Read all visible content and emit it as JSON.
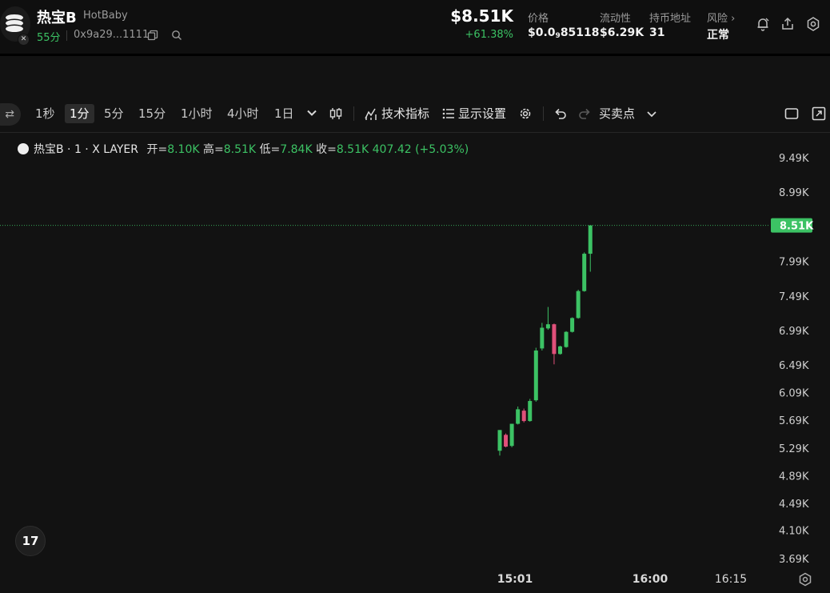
{
  "header": {
    "token_name": "热宝B",
    "token_symbol": "HotBaby",
    "age": "55分",
    "address": "0x9a29...1111",
    "price": "$8.51K",
    "change": "+61.38%",
    "stats": [
      {
        "label": "价格",
        "value_prefix": "$0.0",
        "value_sub": "9",
        "value_suffix": "85118"
      },
      {
        "label": "流动性",
        "value": "$6.29K"
      },
      {
        "label": "持币地址",
        "value": "31"
      },
      {
        "label": "风险",
        "value": "正常"
      }
    ],
    "icons": [
      "copy-icon",
      "search-icon",
      "bell-icon",
      "share-icon",
      "settings-icon"
    ]
  },
  "toolbar": {
    "timeframes": [
      "1秒",
      "1分",
      "5分",
      "15分",
      "1小时",
      "4小时",
      "1日"
    ],
    "active_timeframe": "1分",
    "indicators_label": "技术指标",
    "display_label": "显示设置",
    "trade_points_label": "买卖点"
  },
  "legend": {
    "symbol": "热宝B · 1 · X LAYER",
    "open_label": "开=",
    "open": "8.10K",
    "high_label": "高=",
    "high": "8.51K",
    "low_label": "低=",
    "low": "7.84K",
    "close_label": "收=",
    "close": "8.51K",
    "change": "407.42 (+5.03%)"
  },
  "chart_data": {
    "type": "candlestick",
    "y_ticks": [
      "9.49K",
      "8.99K",
      "8.51K",
      "7.99K",
      "7.49K",
      "6.99K",
      "6.49K",
      "6.09K",
      "5.69K",
      "5.29K",
      "4.89K",
      "4.49K",
      "4.10K",
      "3.69K"
    ],
    "y_tick_values": [
      9490,
      8990,
      8510,
      7990,
      7490,
      6990,
      6490,
      6090,
      5690,
      5290,
      4890,
      4490,
      4100,
      3690
    ],
    "x_ticks": [
      "15:01",
      "16:00",
      "16:15"
    ],
    "current_price_label": "8.51K",
    "current_price": 8510,
    "up_color": "#3cc264",
    "down_color": "#e0507a",
    "candles": [
      {
        "open": 5250,
        "high": 5550,
        "low": 5180,
        "close": 5550
      },
      {
        "open": 5480,
        "high": 5500,
        "low": 5300,
        "close": 5310
      },
      {
        "open": 5320,
        "high": 5640,
        "low": 5300,
        "close": 5640
      },
      {
        "open": 5640,
        "high": 5890,
        "low": 5630,
        "close": 5850
      },
      {
        "open": 5830,
        "high": 5860,
        "low": 5660,
        "close": 5680
      },
      {
        "open": 5680,
        "high": 6000,
        "low": 5670,
        "close": 5970
      },
      {
        "open": 5980,
        "high": 6740,
        "low": 5960,
        "close": 6700
      },
      {
        "open": 6730,
        "high": 7100,
        "low": 6700,
        "close": 7030
      },
      {
        "open": 7020,
        "high": 7330,
        "low": 7000,
        "close": 7080
      },
      {
        "open": 7080,
        "high": 7090,
        "low": 6500,
        "close": 6650
      },
      {
        "open": 6650,
        "high": 6770,
        "low": 6640,
        "close": 6760
      },
      {
        "open": 6750,
        "high": 6980,
        "low": 6740,
        "close": 6970
      },
      {
        "open": 6970,
        "high": 7180,
        "low": 6960,
        "close": 7170
      },
      {
        "open": 7170,
        "high": 7580,
        "low": 7160,
        "close": 7560
      },
      {
        "open": 7560,
        "high": 8120,
        "low": 7550,
        "close": 8100
      },
      {
        "open": 8100,
        "high": 8510,
        "low": 7840,
        "close": 8510
      }
    ]
  }
}
